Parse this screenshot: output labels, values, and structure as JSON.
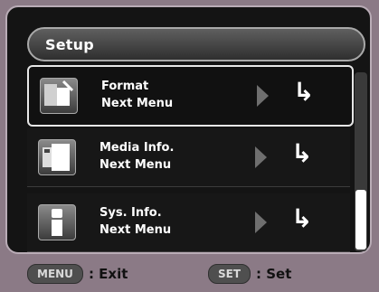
{
  "screen_title": "Setup",
  "menu": {
    "items": [
      {
        "title": "Format",
        "subtitle": "Next Menu",
        "icon": "format-icon",
        "selected": true
      },
      {
        "title": "Media Info.",
        "subtitle": "Next Menu",
        "icon": "media-info-icon",
        "selected": false
      },
      {
        "title": "Sys. Info.",
        "subtitle": "Next Menu",
        "icon": "system-info-icon",
        "selected": false
      }
    ]
  },
  "footer": {
    "exit_key": "MENU",
    "exit_label": ": Exit",
    "set_key": "SET",
    "set_label": ": Set"
  }
}
